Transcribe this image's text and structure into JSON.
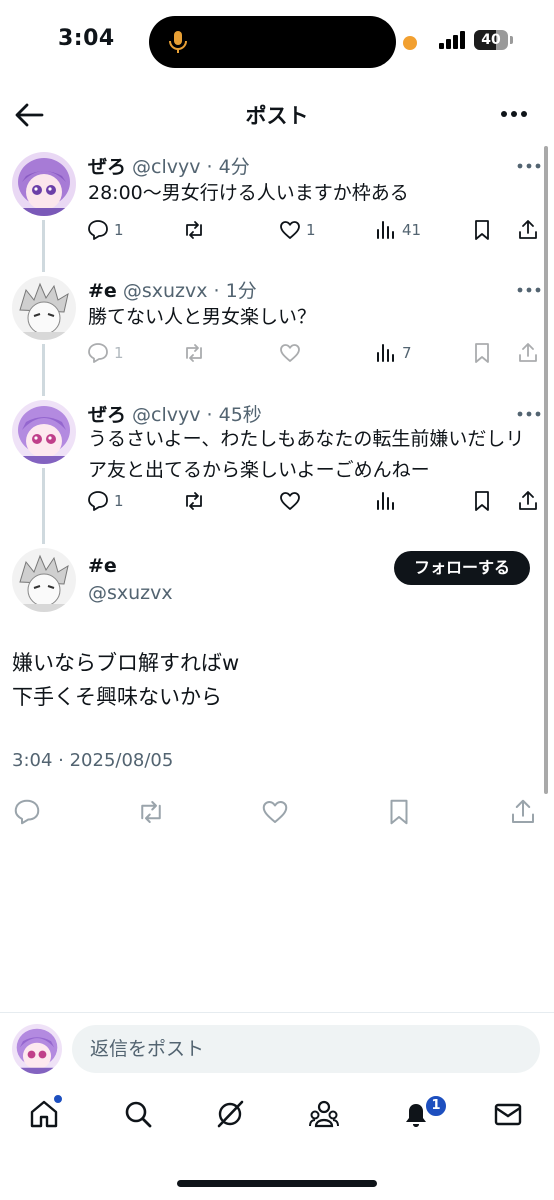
{
  "status": {
    "time": "3:04",
    "battery": "40"
  },
  "header": {
    "title": "ポスト"
  },
  "tweets": [
    {
      "name": "ぜろ",
      "meta": " @clvyv · 4分",
      "text": "28:00〜男女行ける人いますか枠ある",
      "reply_count": "1",
      "retweet_count": "",
      "like_count": "1",
      "view_count": "41"
    },
    {
      "name": "#e",
      "meta": " @sxuzvx · 1分",
      "text": "勝てない人と男女楽しい？",
      "reply_count": "1",
      "retweet_count": "",
      "like_count": "",
      "view_count": "7"
    },
    {
      "name": "ぜろ",
      "meta": " @clvyv · 45秒",
      "text": "うるさいよー、わたしもあなたの転生前嫌いだしリア友と出てるから楽しいよーごめんねー",
      "reply_count": "1",
      "retweet_count": "",
      "like_count": "",
      "view_count": ""
    }
  ],
  "main_post": {
    "name": "#e",
    "handle": "@sxuzvx",
    "follow_label": "フォローする",
    "text_line1": "嫌いならブロ解すればw",
    "text_line2": "下手くそ興味ないから",
    "timestamp": "3:04 · 2025/08/05"
  },
  "reply": {
    "placeholder": "返信をポスト"
  },
  "nav": {
    "notification_badge": "1"
  },
  "colors": {
    "text": "#0f1419",
    "secondary": "#536471",
    "accent": "#1d4fbf",
    "border": "#cfd9de"
  }
}
